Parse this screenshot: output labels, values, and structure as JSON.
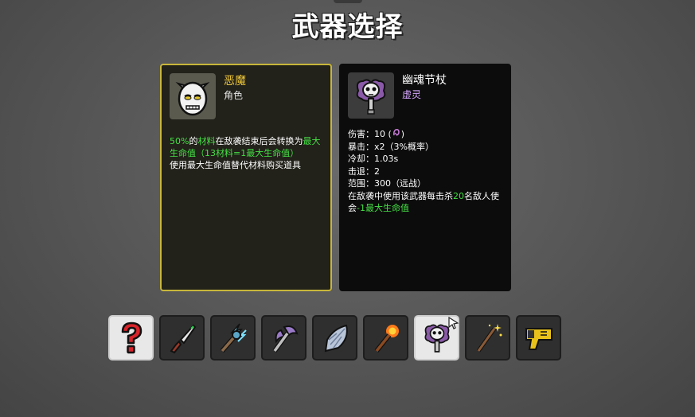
{
  "title": "武器选择",
  "character_card": {
    "name": "恶魔",
    "type": "角色",
    "desc": {
      "p1": "50%",
      "p2": "的",
      "p3": "材料",
      "p4": "在敌袭结束后会转换为",
      "p5": "最大生命值",
      "p6": "（13材料=1最大生命值）",
      "p7": "使用最大生命值替代材料购买道具"
    }
  },
  "weapon_card": {
    "name": "幽魂节杖",
    "type": "虚灵",
    "stats": {
      "damage_label": "伤害：",
      "damage_value": "10 (",
      "damage_close": ")",
      "crit_label": "暴击：",
      "crit_value": "x2（3%概率）",
      "cooldown_label": "冷却：",
      "cooldown_value": "1.03s",
      "knockback_label": "击退：",
      "knockback_value": "2",
      "range_label": "范围：",
      "range_value": "300（远战）"
    },
    "effect": {
      "p1": "在敌袭中使用该武器每击杀",
      "p2": "20",
      "p3": "名敌人使会",
      "p4": "-1最大生命值"
    }
  },
  "weapon_slots": [
    {
      "icon": "random-question-icon"
    },
    {
      "icon": "knife-icon"
    },
    {
      "icon": "lightning-staff-icon"
    },
    {
      "icon": "axe-icon"
    },
    {
      "icon": "crystal-shard-icon"
    },
    {
      "icon": "torch-icon"
    },
    {
      "icon": "ghost-scepter-icon",
      "selected": true
    },
    {
      "icon": "magic-wand-icon"
    },
    {
      "icon": "taser-icon"
    }
  ],
  "colors": {
    "accent_gold": "#c8b63a",
    "highlight_green": "#45e045",
    "weapon_class_purple": "#d7a8ff"
  }
}
